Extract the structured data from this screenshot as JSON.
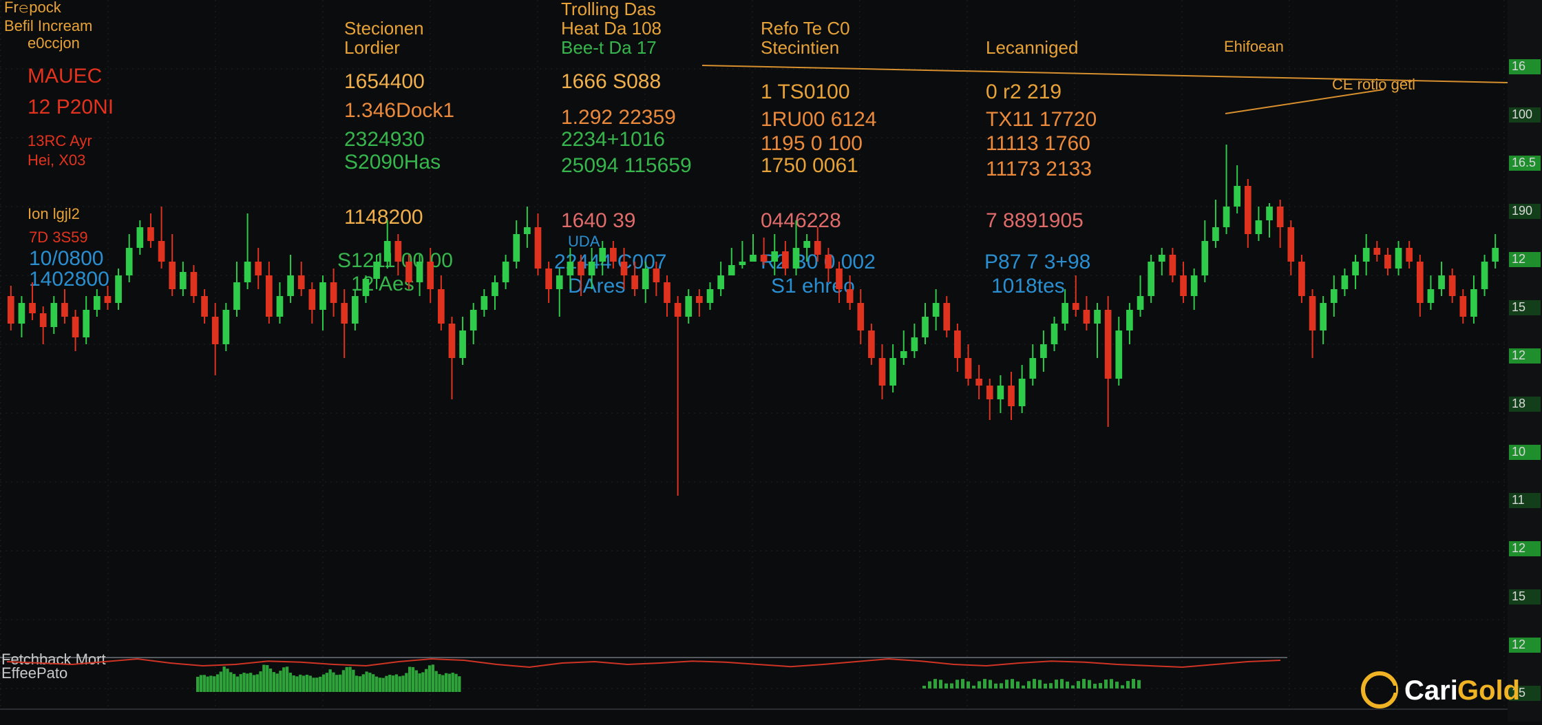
{
  "colors": {
    "background": "#0b0c0e",
    "grid": "#1f2227",
    "up": "#2ecc4a",
    "down": "#e0331f",
    "header_text": "#e8a338",
    "value_amber": "#f1b04c",
    "value_orange": "#ec8a3c",
    "value_green": "#36b64c",
    "value_blue": "#2a8fd0",
    "value_red": "#e3331e",
    "value_pink": "#e06b6b",
    "trend_line": "#d8902e",
    "volume_green": "#2ea33a",
    "volume_red": "#cf3424",
    "axis_panel": "#0f1113",
    "logo_accent": "#f0b323"
  },
  "header": {
    "col1": {
      "title_a": "Fr𝚎pock",
      "title_b": "Befil Incream",
      "title_c": "e0ccjon"
    },
    "col2": {
      "title_a": "Stecionen",
      "title_b": "Lordier"
    },
    "col3": {
      "title_a": "Trolling Das",
      "title_b": "Heat Da 108",
      "title_c": "Bee-t Da 17"
    },
    "col4": {
      "title_a": "Refo Te C0",
      "title_b": "Stecintien"
    },
    "col5": {
      "title": "Lecanniged"
    },
    "col6": {
      "title": "Ehifoean"
    },
    "annotation": "CE rotio geti"
  },
  "rows": {
    "r1": [
      "MAUEC",
      "1654400",
      "1666 S088",
      "1 TS0100",
      "0 r2 219"
    ],
    "r2": [
      "12 P20NI",
      "1.346Dock1",
      "1.292 22359",
      "1RU00 6124",
      "TX11 17720"
    ],
    "r3": [
      "13RC Ayr",
      "2324930",
      "2234+1016",
      "1195 0 100",
      "11113 1760"
    ],
    "r4": [
      "Hei, X03",
      "S2090Has",
      "25094 115659",
      "1750 0061",
      "11173 2133"
    ],
    "r5": [
      "Ion lgjl2",
      "1148200",
      "1640 39",
      "0446228",
      "7 8891905"
    ],
    "r6": [
      "7D 3S59",
      "",
      "UDA",
      "",
      ""
    ],
    "r7": [
      "10/0800",
      "S1211 00 00",
      "22444 C007",
      "R2 B0 0 002",
      "P87 7 3+98"
    ],
    "r8": [
      "1402800",
      "12 Aes",
      "DAres",
      "S1 ehreo",
      "1018tes"
    ]
  },
  "footer": {
    "volume_label": "Fetchback Mort",
    "volume_sublabel": "EffeePato"
  },
  "logo": {
    "brand_a": "Cari",
    "brand_b": "Gold"
  },
  "y_axis_ticks": [
    "16",
    "100",
    "16.5",
    "190",
    "12",
    "15",
    "12",
    "18",
    "10",
    "11",
    "12",
    "15",
    "12",
    "15"
  ],
  "chart_data": {
    "type": "candlestick",
    "title": "",
    "xlabel": "",
    "ylabel": "",
    "grid": true,
    "candles": [
      {
        "o": 430,
        "c": 470,
        "h": 415,
        "l": 480
      },
      {
        "o": 470,
        "c": 440,
        "h": 430,
        "l": 490
      },
      {
        "o": 440,
        "c": 455,
        "h": 410,
        "l": 465
      },
      {
        "o": 455,
        "c": 475,
        "h": 445,
        "l": 500
      },
      {
        "o": 475,
        "c": 440,
        "h": 430,
        "l": 485
      },
      {
        "o": 440,
        "c": 460,
        "h": 420,
        "l": 470
      },
      {
        "o": 460,
        "c": 490,
        "h": 450,
        "l": 510
      },
      {
        "o": 490,
        "c": 450,
        "h": 430,
        "l": 500
      },
      {
        "o": 450,
        "c": 430,
        "h": 420,
        "l": 460
      },
      {
        "o": 430,
        "c": 440,
        "h": 415,
        "l": 450
      },
      {
        "o": 440,
        "c": 400,
        "h": 390,
        "l": 450
      },
      {
        "o": 400,
        "c": 360,
        "h": 340,
        "l": 410
      },
      {
        "o": 360,
        "c": 330,
        "h": 320,
        "l": 370
      },
      {
        "o": 330,
        "c": 350,
        "h": 310,
        "l": 360
      },
      {
        "o": 350,
        "c": 380,
        "h": 300,
        "l": 390
      },
      {
        "o": 380,
        "c": 420,
        "h": 340,
        "l": 430
      },
      {
        "o": 420,
        "c": 395,
        "h": 380,
        "l": 430
      },
      {
        "o": 395,
        "c": 430,
        "h": 385,
        "l": 440
      },
      {
        "o": 430,
        "c": 460,
        "h": 420,
        "l": 470
      },
      {
        "o": 460,
        "c": 500,
        "h": 440,
        "l": 545
      },
      {
        "o": 500,
        "c": 450,
        "h": 440,
        "l": 510
      },
      {
        "o": 450,
        "c": 410,
        "h": 380,
        "l": 460
      },
      {
        "o": 410,
        "c": 380,
        "h": 310,
        "l": 420
      },
      {
        "o": 380,
        "c": 400,
        "h": 360,
        "l": 420
      },
      {
        "o": 400,
        "c": 460,
        "h": 380,
        "l": 470
      },
      {
        "o": 460,
        "c": 430,
        "h": 410,
        "l": 470
      },
      {
        "o": 430,
        "c": 400,
        "h": 370,
        "l": 440
      },
      {
        "o": 400,
        "c": 420,
        "h": 380,
        "l": 430
      },
      {
        "o": 420,
        "c": 450,
        "h": 410,
        "l": 470
      },
      {
        "o": 450,
        "c": 410,
        "h": 400,
        "l": 480
      },
      {
        "o": 410,
        "c": 440,
        "h": 390,
        "l": 460
      },
      {
        "o": 440,
        "c": 470,
        "h": 420,
        "l": 520
      },
      {
        "o": 470,
        "c": 430,
        "h": 420,
        "l": 480
      },
      {
        "o": 430,
        "c": 405,
        "h": 400,
        "l": 440
      },
      {
        "o": 405,
        "c": 380,
        "h": 370,
        "l": 420
      },
      {
        "o": 380,
        "c": 350,
        "h": 320,
        "l": 390
      },
      {
        "o": 350,
        "c": 380,
        "h": 340,
        "l": 400
      },
      {
        "o": 380,
        "c": 410,
        "h": 370,
        "l": 420
      },
      {
        "o": 410,
        "c": 380,
        "h": 370,
        "l": 430
      },
      {
        "o": 380,
        "c": 420,
        "h": 360,
        "l": 440
      },
      {
        "o": 420,
        "c": 470,
        "h": 400,
        "l": 480
      },
      {
        "o": 470,
        "c": 520,
        "h": 460,
        "l": 580
      },
      {
        "o": 520,
        "c": 480,
        "h": 460,
        "l": 530
      },
      {
        "o": 480,
        "c": 450,
        "h": 440,
        "l": 500
      },
      {
        "o": 450,
        "c": 430,
        "h": 420,
        "l": 460
      },
      {
        "o": 430,
        "c": 410,
        "h": 400,
        "l": 450
      },
      {
        "o": 410,
        "c": 380,
        "h": 370,
        "l": 420
      },
      {
        "o": 380,
        "c": 340,
        "h": 320,
        "l": 390
      },
      {
        "o": 340,
        "c": 330,
        "h": 300,
        "l": 360
      },
      {
        "o": 330,
        "c": 390,
        "h": 310,
        "l": 400
      },
      {
        "o": 390,
        "c": 420,
        "h": 380,
        "l": 440
      },
      {
        "o": 420,
        "c": 400,
        "h": 390,
        "l": 460
      },
      {
        "o": 400,
        "c": 380,
        "h": 360,
        "l": 420
      },
      {
        "o": 380,
        "c": 400,
        "h": 370,
        "l": 430
      },
      {
        "o": 400,
        "c": 380,
        "h": 360,
        "l": 420
      },
      {
        "o": 380,
        "c": 360,
        "h": 350,
        "l": 400
      },
      {
        "o": 360,
        "c": 380,
        "h": 350,
        "l": 390
      },
      {
        "o": 380,
        "c": 400,
        "h": 360,
        "l": 420
      },
      {
        "o": 400,
        "c": 420,
        "h": 380,
        "l": 430
      },
      {
        "o": 420,
        "c": 390,
        "h": 380,
        "l": 440
      },
      {
        "o": 390,
        "c": 410,
        "h": 380,
        "l": 430
      },
      {
        "o": 410,
        "c": 440,
        "h": 400,
        "l": 460
      },
      {
        "o": 440,
        "c": 460,
        "h": 430,
        "l": 720
      },
      {
        "o": 460,
        "c": 430,
        "h": 420,
        "l": 470
      },
      {
        "o": 430,
        "c": 440,
        "h": 420,
        "l": 460
      },
      {
        "o": 440,
        "c": 420,
        "h": 410,
        "l": 450
      },
      {
        "o": 420,
        "c": 400,
        "h": 380,
        "l": 430
      },
      {
        "o": 400,
        "c": 385,
        "h": 360,
        "l": 400
      },
      {
        "o": 385,
        "c": 380,
        "h": 350,
        "l": 390
      },
      {
        "o": 380,
        "c": 370,
        "h": 340,
        "l": 380
      },
      {
        "o": 370,
        "c": 380,
        "h": 345,
        "l": 385
      },
      {
        "o": 380,
        "c": 365,
        "h": 340,
        "l": 400
      },
      {
        "o": 365,
        "c": 390,
        "h": 350,
        "l": 400
      },
      {
        "o": 390,
        "c": 360,
        "h": 320,
        "l": 400
      },
      {
        "o": 360,
        "c": 350,
        "h": 340,
        "l": 380
      },
      {
        "o": 350,
        "c": 370,
        "h": 330,
        "l": 380
      },
      {
        "o": 370,
        "c": 390,
        "h": 360,
        "l": 410
      },
      {
        "o": 390,
        "c": 420,
        "h": 380,
        "l": 440
      },
      {
        "o": 420,
        "c": 440,
        "h": 400,
        "l": 450
      },
      {
        "o": 440,
        "c": 480,
        "h": 420,
        "l": 500
      },
      {
        "o": 480,
        "c": 520,
        "h": 470,
        "l": 530
      },
      {
        "o": 520,
        "c": 560,
        "h": 500,
        "l": 580
      },
      {
        "o": 560,
        "c": 520,
        "h": 500,
        "l": 570
      },
      {
        "o": 520,
        "c": 510,
        "h": 480,
        "l": 530
      },
      {
        "o": 510,
        "c": 490,
        "h": 470,
        "l": 520
      },
      {
        "o": 490,
        "c": 460,
        "h": 440,
        "l": 500
      },
      {
        "o": 460,
        "c": 440,
        "h": 420,
        "l": 480
      },
      {
        "o": 440,
        "c": 480,
        "h": 430,
        "l": 490
      },
      {
        "o": 480,
        "c": 520,
        "h": 470,
        "l": 540
      },
      {
        "o": 520,
        "c": 550,
        "h": 500,
        "l": 560
      },
      {
        "o": 550,
        "c": 560,
        "h": 530,
        "l": 580
      },
      {
        "o": 560,
        "c": 580,
        "h": 550,
        "l": 610
      },
      {
        "o": 580,
        "c": 560,
        "h": 545,
        "l": 600
      },
      {
        "o": 560,
        "c": 590,
        "h": 540,
        "l": 610
      },
      {
        "o": 590,
        "c": 550,
        "h": 530,
        "l": 600
      },
      {
        "o": 550,
        "c": 520,
        "h": 500,
        "l": 560
      },
      {
        "o": 520,
        "c": 500,
        "h": 480,
        "l": 540
      },
      {
        "o": 500,
        "c": 470,
        "h": 460,
        "l": 510
      },
      {
        "o": 470,
        "c": 440,
        "h": 420,
        "l": 480
      },
      {
        "o": 440,
        "c": 450,
        "h": 400,
        "l": 460
      },
      {
        "o": 450,
        "c": 470,
        "h": 430,
        "l": 480
      },
      {
        "o": 470,
        "c": 450,
        "h": 440,
        "l": 520
      },
      {
        "o": 450,
        "c": 550,
        "h": 430,
        "l": 620
      },
      {
        "o": 550,
        "c": 480,
        "h": 460,
        "l": 560
      },
      {
        "o": 480,
        "c": 450,
        "h": 440,
        "l": 500
      },
      {
        "o": 450,
        "c": 430,
        "h": 400,
        "l": 460
      },
      {
        "o": 430,
        "c": 380,
        "h": 370,
        "l": 440
      },
      {
        "o": 380,
        "c": 370,
        "h": 360,
        "l": 400
      },
      {
        "o": 370,
        "c": 400,
        "h": 360,
        "l": 410
      },
      {
        "o": 400,
        "c": 430,
        "h": 380,
        "l": 440
      },
      {
        "o": 430,
        "c": 400,
        "h": 390,
        "l": 450
      },
      {
        "o": 400,
        "c": 350,
        "h": 320,
        "l": 410
      },
      {
        "o": 350,
        "c": 330,
        "h": 290,
        "l": 360
      },
      {
        "o": 330,
        "c": 300,
        "h": 210,
        "l": 340
      },
      {
        "o": 300,
        "c": 270,
        "h": 240,
        "l": 310
      },
      {
        "o": 270,
        "c": 340,
        "h": 260,
        "l": 360
      },
      {
        "o": 340,
        "c": 320,
        "h": 300,
        "l": 350
      },
      {
        "o": 320,
        "c": 300,
        "h": 295,
        "l": 345
      },
      {
        "o": 300,
        "c": 330,
        "h": 290,
        "l": 360
      },
      {
        "o": 330,
        "c": 380,
        "h": 320,
        "l": 400
      },
      {
        "o": 380,
        "c": 430,
        "h": 370,
        "l": 440
      },
      {
        "o": 430,
        "c": 480,
        "h": 420,
        "l": 520
      },
      {
        "o": 480,
        "c": 440,
        "h": 430,
        "l": 500
      },
      {
        "o": 440,
        "c": 420,
        "h": 400,
        "l": 460
      },
      {
        "o": 420,
        "c": 400,
        "h": 390,
        "l": 430
      },
      {
        "o": 400,
        "c": 380,
        "h": 370,
        "l": 420
      },
      {
        "o": 380,
        "c": 360,
        "h": 340,
        "l": 400
      },
      {
        "o": 360,
        "c": 370,
        "h": 350,
        "l": 380
      },
      {
        "o": 370,
        "c": 390,
        "h": 360,
        "l": 400
      },
      {
        "o": 390,
        "c": 360,
        "h": 350,
        "l": 400
      },
      {
        "o": 360,
        "c": 380,
        "h": 350,
        "l": 390
      },
      {
        "o": 380,
        "c": 440,
        "h": 370,
        "l": 460
      },
      {
        "o": 440,
        "c": 420,
        "h": 400,
        "l": 450
      },
      {
        "o": 420,
        "c": 400,
        "h": 380,
        "l": 430
      },
      {
        "o": 400,
        "c": 430,
        "h": 390,
        "l": 440
      },
      {
        "o": 430,
        "c": 460,
        "h": 420,
        "l": 470
      },
      {
        "o": 460,
        "c": 420,
        "h": 400,
        "l": 470
      },
      {
        "o": 420,
        "c": 380,
        "h": 370,
        "l": 430
      },
      {
        "o": 380,
        "c": 360,
        "h": 340,
        "l": 390
      }
    ],
    "trend_line_upper": [
      [
        1020,
        95
      ],
      [
        2190,
        120
      ]
    ],
    "trend_line_lower": [
      [
        1780,
        165
      ],
      [
        2010,
        130
      ]
    ],
    "volume_green_profile": [
      0.5,
      0.7,
      0.9,
      0.6,
      0.8,
      1.0,
      0.9,
      0.7,
      0.5,
      0.6,
      0.8,
      0.9,
      0.7,
      0.6,
      0.5,
      0.7,
      0.9,
      1.0,
      0.8,
      0.6
    ],
    "indicator_line": [
      0.6,
      0.55,
      0.5,
      0.6,
      0.7,
      0.55,
      0.45,
      0.5,
      0.62,
      0.58,
      0.5,
      0.45,
      0.6,
      0.7,
      0.65,
      0.5,
      0.4,
      0.55,
      0.6,
      0.5,
      0.55,
      0.62,
      0.58,
      0.5,
      0.42,
      0.5,
      0.6,
      0.7,
      0.62,
      0.5,
      0.45,
      0.55,
      0.62,
      0.58,
      0.5,
      0.45,
      0.4,
      0.5,
      0.6,
      0.65
    ]
  }
}
